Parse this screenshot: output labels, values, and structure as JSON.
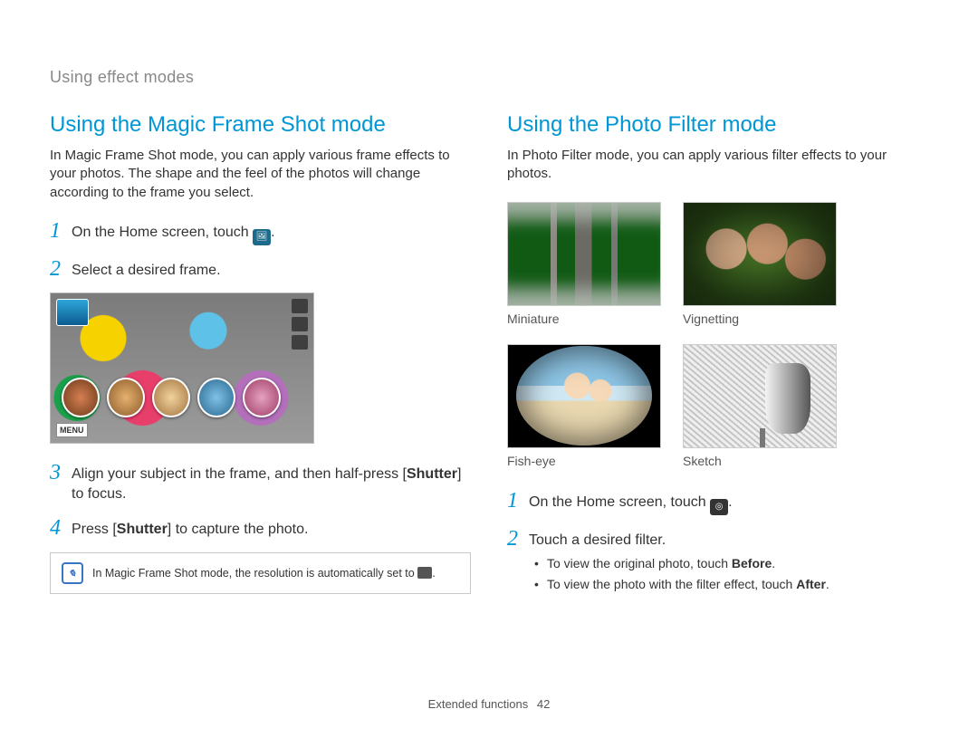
{
  "breadcrumb": "Using effect modes",
  "left": {
    "title": "Using the Magic Frame Shot mode",
    "intro": "In Magic Frame Shot mode, you can apply various frame effects to your photos. The shape and the feel of the photos will change according to the frame you select.",
    "steps": {
      "s1": "On the Home screen, touch ",
      "s2": "Select a desired frame.",
      "s3a": "Align your subject in the frame, and then half-press [",
      "s3b": "Shutter",
      "s3c": "] to focus.",
      "s4a": "Press [",
      "s4b": "Shutter",
      "s4c": "] to capture the photo."
    },
    "menu_label": "MENU",
    "note": "In Magic Frame Shot mode, the resolution is automatically set to "
  },
  "right": {
    "title": "Using the Photo Filter mode",
    "intro": "In Photo Filter mode, you can apply various filter effects to your photos.",
    "filters": {
      "miniature": "Miniature",
      "vignetting": "Vignetting",
      "fisheye": "Fish-eye",
      "sketch": "Sketch"
    },
    "steps": {
      "s1": "On the Home screen, touch ",
      "s2": "Touch a desired filter."
    },
    "bullets": {
      "b1a": "To view the original photo, touch ",
      "b1b": "Before",
      "b1c": ".",
      "b2a": "To view the photo with the filter effect, touch ",
      "b2b": "After",
      "b2c": "."
    }
  },
  "footer": {
    "section": "Extended functions",
    "page": "42"
  }
}
